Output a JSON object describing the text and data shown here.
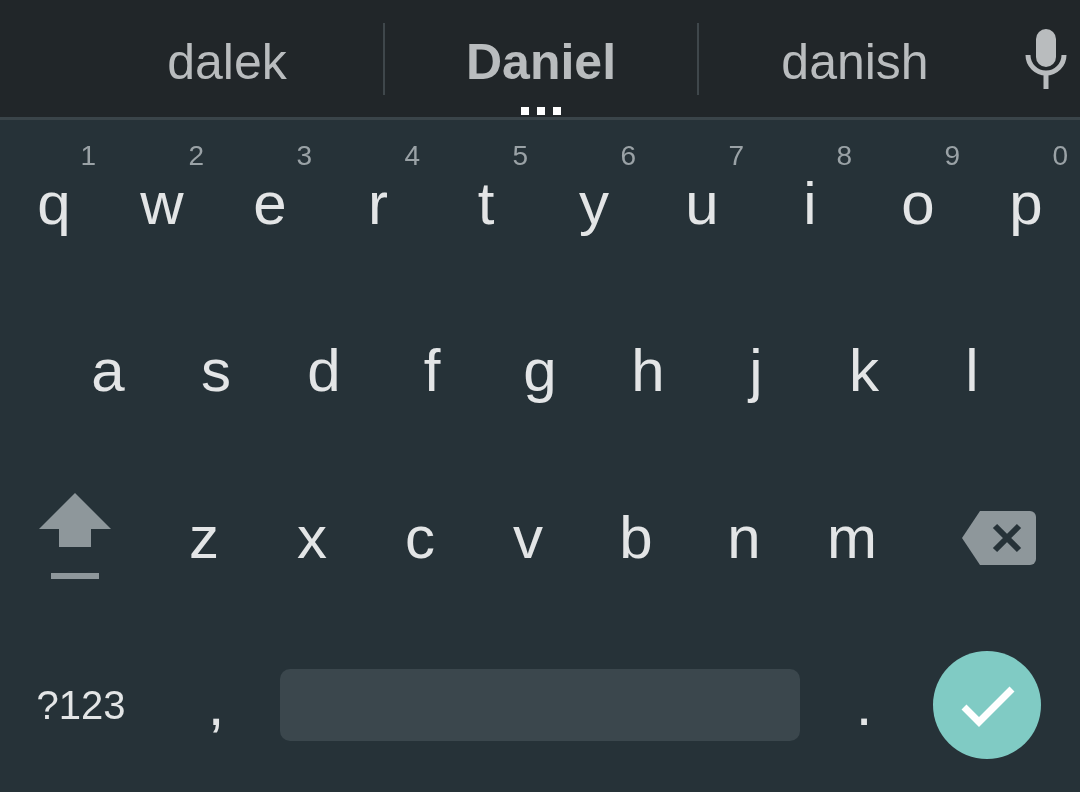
{
  "suggestions": [
    {
      "text": "dalek",
      "selected": false
    },
    {
      "text": "Daniel",
      "selected": true
    },
    {
      "text": "danish",
      "selected": false
    }
  ],
  "rows": [
    {
      "keys": [
        {
          "kind": "letter",
          "label": "q",
          "hint": "1"
        },
        {
          "kind": "letter",
          "label": "w",
          "hint": "2"
        },
        {
          "kind": "letter",
          "label": "e",
          "hint": "3"
        },
        {
          "kind": "letter",
          "label": "r",
          "hint": "4"
        },
        {
          "kind": "letter",
          "label": "t",
          "hint": "5"
        },
        {
          "kind": "letter",
          "label": "y",
          "hint": "6"
        },
        {
          "kind": "letter",
          "label": "u",
          "hint": "7"
        },
        {
          "kind": "letter",
          "label": "i",
          "hint": "8"
        },
        {
          "kind": "letter",
          "label": "o",
          "hint": "9"
        },
        {
          "kind": "letter",
          "label": "p",
          "hint": "0"
        }
      ]
    },
    {
      "keys": [
        {
          "kind": "letter",
          "label": "a"
        },
        {
          "kind": "letter",
          "label": "s"
        },
        {
          "kind": "letter",
          "label": "d"
        },
        {
          "kind": "letter",
          "label": "f"
        },
        {
          "kind": "letter",
          "label": "g"
        },
        {
          "kind": "letter",
          "label": "h"
        },
        {
          "kind": "letter",
          "label": "j"
        },
        {
          "kind": "letter",
          "label": "k"
        },
        {
          "kind": "letter",
          "label": "l"
        }
      ]
    },
    {
      "keys": [
        {
          "kind": "shift"
        },
        {
          "kind": "letter",
          "label": "z"
        },
        {
          "kind": "letter",
          "label": "x"
        },
        {
          "kind": "letter",
          "label": "c"
        },
        {
          "kind": "letter",
          "label": "v"
        },
        {
          "kind": "letter",
          "label": "b"
        },
        {
          "kind": "letter",
          "label": "n"
        },
        {
          "kind": "letter",
          "label": "m"
        },
        {
          "kind": "delete"
        }
      ]
    },
    {
      "keys": [
        {
          "kind": "symbols",
          "label": "?123"
        },
        {
          "kind": "letter",
          "label": ","
        },
        {
          "kind": "space"
        },
        {
          "kind": "letter",
          "label": "."
        },
        {
          "kind": "enter"
        }
      ]
    }
  ]
}
